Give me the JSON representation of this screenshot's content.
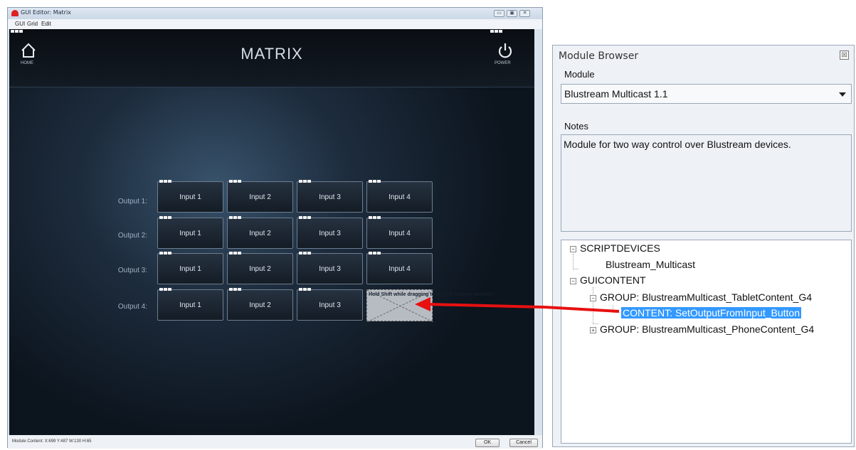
{
  "editor": {
    "title": "GUI Editor: Matrix",
    "menu": [
      "GUI",
      "Grid",
      "Edit"
    ],
    "page_title": "MATRIX",
    "home_label": "HOME",
    "power_label": "POWER",
    "rows": [
      {
        "label": "Output 1:",
        "buttons": [
          "Input 1",
          "Input 2",
          "Input 3",
          "Input 4"
        ]
      },
      {
        "label": "Output 2:",
        "buttons": [
          "Input 1",
          "Input 2",
          "Input 3",
          "Input 4"
        ]
      },
      {
        "label": "Output 3:",
        "buttons": [
          "Input 1",
          "Input 2",
          "Input 3",
          "Input 4"
        ]
      },
      {
        "label": "Output 4:",
        "buttons": [
          "Input 1",
          "Input 2",
          "Input 3"
        ]
      }
    ],
    "drag_hint": "Hold Shift while dragging to drop at custom position",
    "status": "Module Content: X:699 Y:487 W:130 H:65",
    "ok_label": "OK",
    "cancel_label": "Cancel",
    "window_controls": [
      "▭",
      "▣",
      "✕"
    ]
  },
  "browser": {
    "title": "Module Browser",
    "close_glyph": "☒",
    "module_label": "Module",
    "module_selected": "Blustream Multicast 1.1",
    "notes_label": "Notes",
    "notes_text": "Module for two way control over Blustream devices.",
    "tree": {
      "scriptdevices": "SCRIPTDEVICES",
      "device": "Blustream_Multicast",
      "guicontent": "GUICONTENT",
      "group_tablet": "GROUP: BlustreamMulticast_TabletContent_G4",
      "content_item": "CONTENT: SetOutputFromInput_Button",
      "group_phone": "GROUP: BlustreamMulticast_PhoneContent_G4"
    }
  },
  "colors": {
    "selection": "#3399ff",
    "arrow": "#e81010"
  }
}
